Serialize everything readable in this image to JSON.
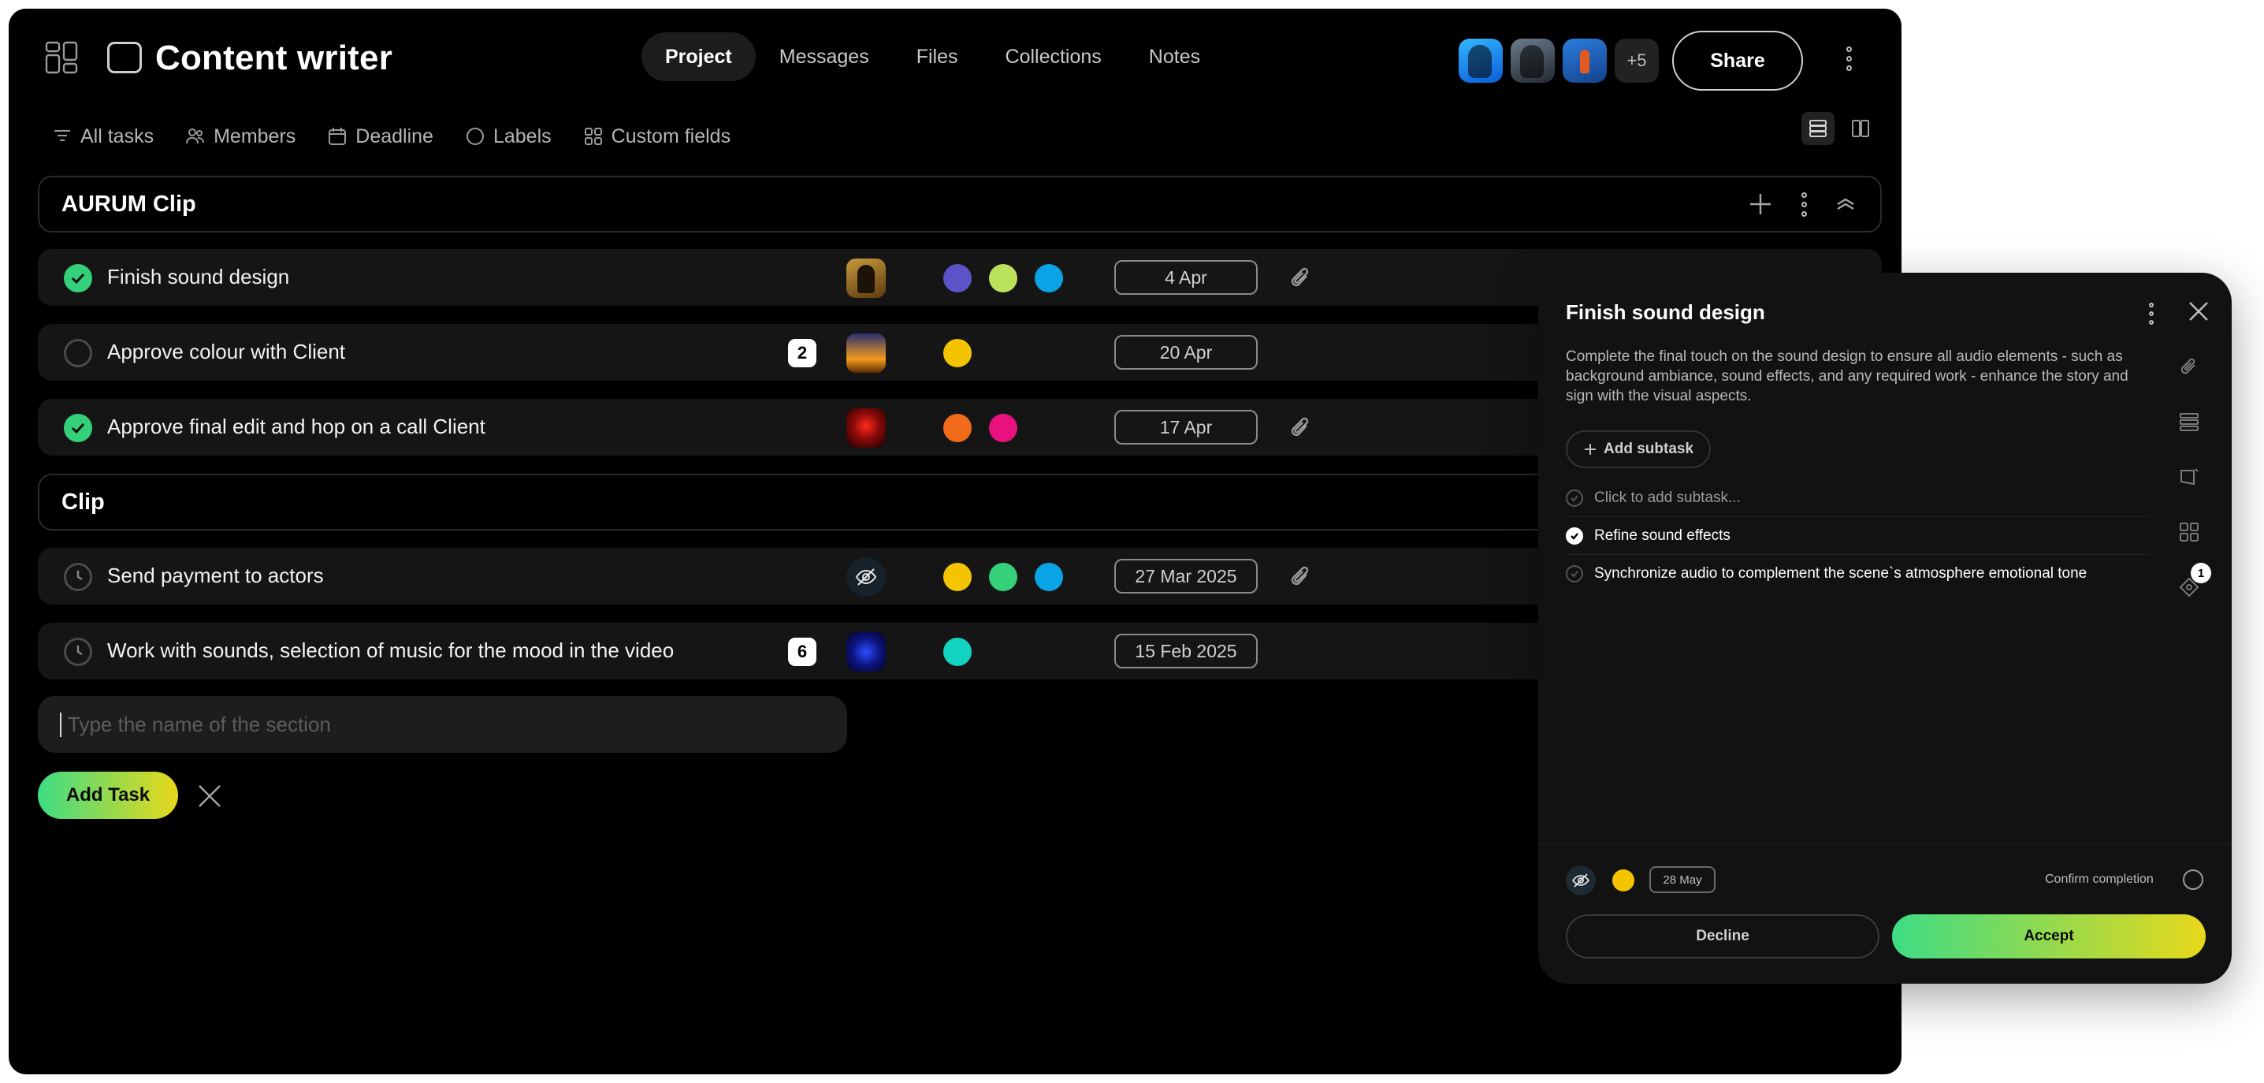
{
  "header": {
    "title": "Content writer",
    "tabs": [
      {
        "label": "Project",
        "active": true
      },
      {
        "label": "Messages",
        "active": false
      },
      {
        "label": "Files",
        "active": false
      },
      {
        "label": "Collections",
        "active": false
      },
      {
        "label": "Notes",
        "active": false
      }
    ],
    "extra_members": "+5",
    "share_label": "Share"
  },
  "filters": {
    "all_tasks": "All tasks",
    "members": "Members",
    "deadline": "Deadline",
    "labels": "Labels",
    "custom_fields": "Custom fields"
  },
  "sections": [
    {
      "title": "AURUM Clip",
      "tasks": [
        {
          "name": "Finish sound design",
          "status": "done",
          "count": "",
          "labels": [
            "#5a54c8",
            "#b9e25a",
            "#0aa3e6"
          ],
          "date": "4 Apr",
          "attachment": true
        },
        {
          "name": "Approve colour with Client",
          "status": "todo",
          "count": "2",
          "labels": [
            "#f5c400"
          ],
          "date": "20 Apr",
          "attachment": false
        },
        {
          "name": "Approve final edit and hop on a call Client",
          "status": "done",
          "count": "",
          "labels": [
            "#f26b1a",
            "#e8127e"
          ],
          "date": "17 Apr",
          "attachment": true
        }
      ]
    },
    {
      "title": "Clip",
      "tasks": [
        {
          "name": "Send payment to actors",
          "status": "pending",
          "count": "",
          "labels": [
            "#f5c400",
            "#34d17a",
            "#0aa3e6"
          ],
          "date": "27 Mar 2025",
          "attachment": true
        },
        {
          "name": "Work with sounds, selection of music for the mood in the video",
          "status": "pending",
          "count": "6",
          "labels": [
            "#12d3c0"
          ],
          "date": "15 Feb 2025",
          "attachment": false
        }
      ]
    }
  ],
  "new_section": {
    "placeholder": "Type the name of the section"
  },
  "add_task_label": "Add Task",
  "detail": {
    "title": "Finish sound design",
    "description": "Complete the final touch on the sound design to ensure all audio elements - such as background ambiance, sound effects, and any required work - enhance the story and sign with the visual aspects.",
    "add_subtask_label": "Add subtask",
    "subtasks": [
      {
        "text": "Click to add subtask...",
        "done": false,
        "muted": true
      },
      {
        "text": "Refine sound effects",
        "done": true,
        "muted": false
      },
      {
        "text": "Synchronize audio to complement the scene`s atmosphere emotional tone",
        "done": false,
        "muted": false
      }
    ],
    "rail_badge": "1",
    "due_date": "28 May",
    "confirm_label": "Confirm completion",
    "decline_label": "Decline",
    "accept_label": "Accept"
  },
  "colors": {
    "accent_gradient_start": "#3ddc84",
    "accent_gradient_end": "#e8d81a",
    "done_green": "#34d17a",
    "background": "#000000"
  }
}
